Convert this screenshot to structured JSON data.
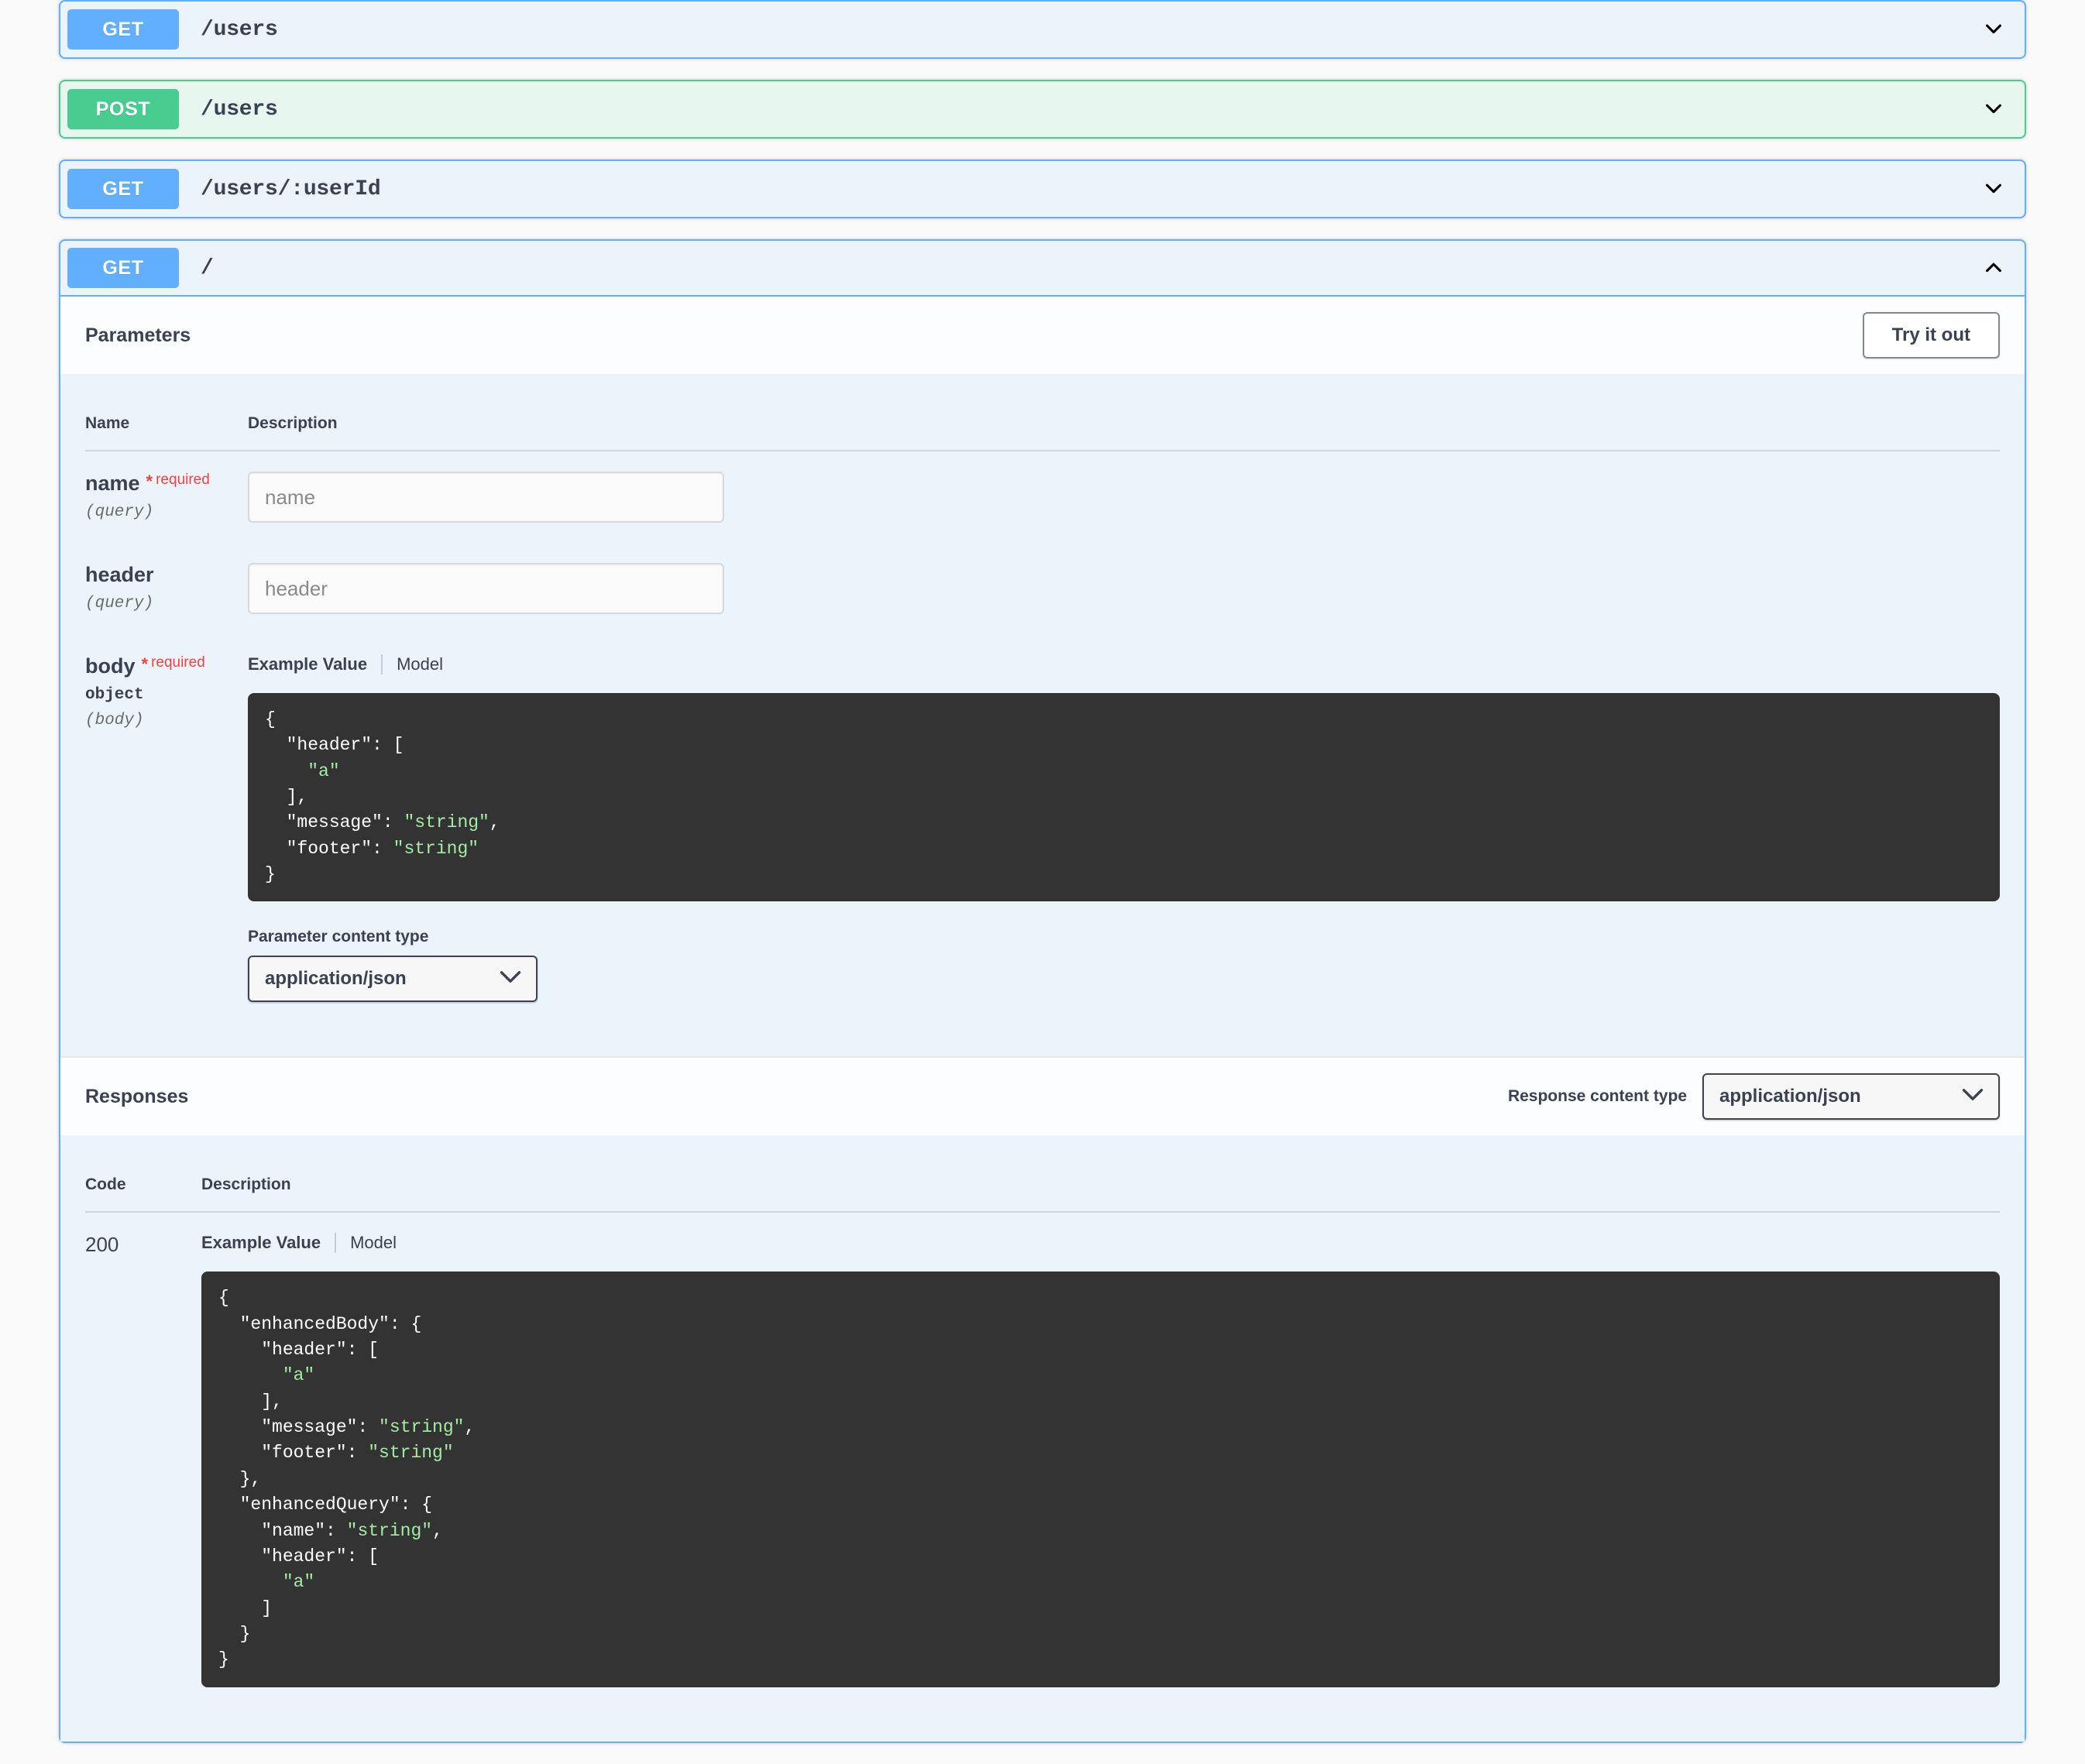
{
  "operations": [
    {
      "method": "GET",
      "path": "/users",
      "expanded": false,
      "arrow": "chevron-down-icon"
    },
    {
      "method": "POST",
      "path": "/users",
      "expanded": false,
      "arrow": "chevron-down-icon"
    },
    {
      "method": "GET",
      "path": "/users/:userId",
      "expanded": false,
      "arrow": "chevron-down-icon"
    },
    {
      "method": "GET",
      "path": "/",
      "expanded": true,
      "arrow": "chevron-up-icon"
    }
  ],
  "expanded_operation": {
    "method": "GET",
    "path": "/",
    "parameters_section": {
      "title": "Parameters",
      "try_it_out_label": "Try it out",
      "columns": {
        "name": "Name",
        "description": "Description"
      },
      "rows": [
        {
          "name": "name",
          "required": true,
          "required_star": "*",
          "required_label": "required",
          "type": "",
          "in": "(query)",
          "input_placeholder": "name",
          "input_value": ""
        },
        {
          "name": "header",
          "required": false,
          "required_star": "",
          "required_label": "",
          "type": "",
          "in": "(query)",
          "input_placeholder": "header",
          "input_value": ""
        },
        {
          "name": "body",
          "required": true,
          "required_star": "*",
          "required_label": "required",
          "type": "object",
          "in": "(body)",
          "example_tab_label": "Example Value",
          "model_tab_label": "Model",
          "example_json": "{\n  \"header\": [\n    \"a\"\n  ],\n  \"message\": \"string\",\n  \"footer\": \"string\"\n}",
          "content_type_label": "Parameter content type",
          "content_type_value": "application/json"
        }
      ]
    },
    "responses_section": {
      "title": "Responses",
      "content_type_label": "Response content type",
      "content_type_value": "application/json",
      "columns": {
        "code": "Code",
        "description": "Description"
      },
      "rows": [
        {
          "code": "200",
          "description": "",
          "example_tab_label": "Example Value",
          "model_tab_label": "Model",
          "example_json": "{\n  \"enhancedBody\": {\n    \"header\": [\n      \"a\"\n    ],\n    \"message\": \"string\",\n    \"footer\": \"string\"\n  },\n  \"enhancedQuery\": {\n    \"name\": \"string\",\n    \"header\": [\n      \"a\"\n    ]\n  }\n}"
        }
      ]
    }
  },
  "colors": {
    "get": "#61affe",
    "post": "#49cc90",
    "get_bg": "#ebf3fb",
    "post_bg": "#e8f6f0",
    "required": "#f93e3e",
    "code_bg": "#333333",
    "code_string": "#a2eda2"
  }
}
